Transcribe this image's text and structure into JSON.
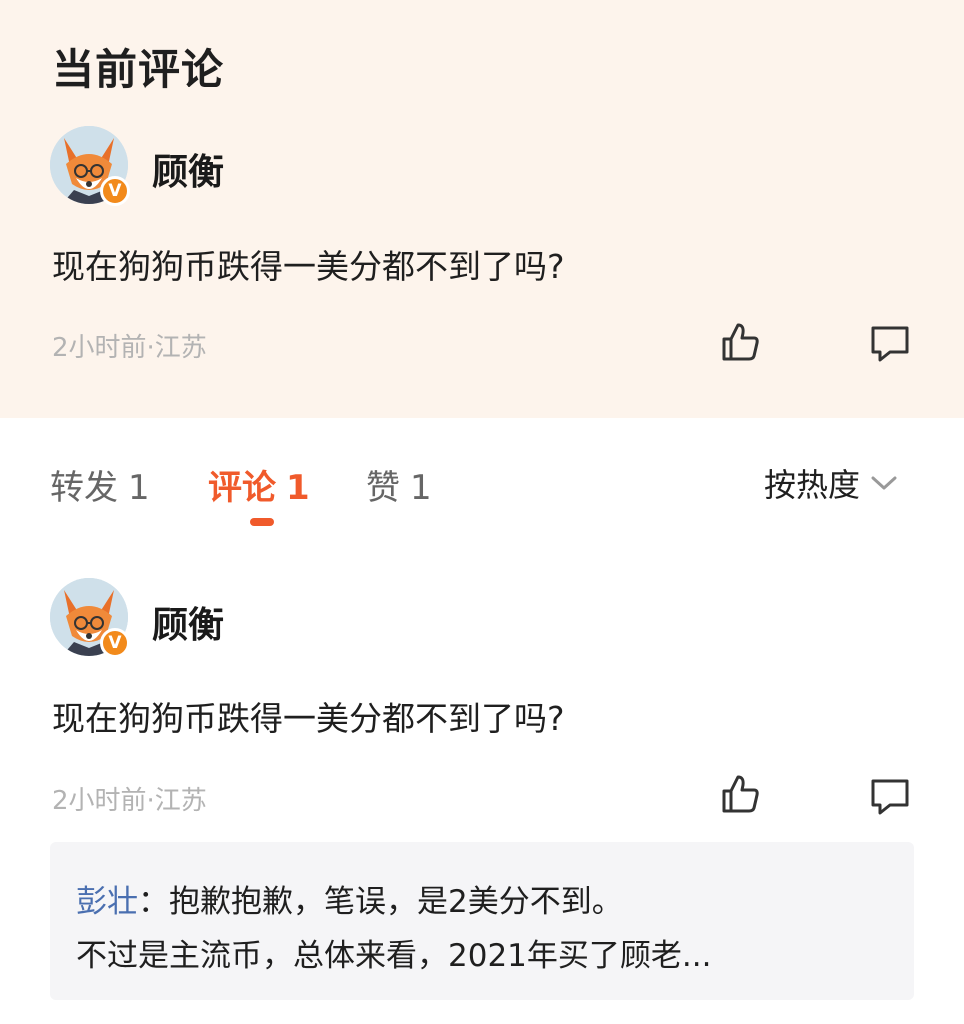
{
  "current_comment": {
    "section_title": "当前评论",
    "author": "顾衡",
    "verified_badge": "V",
    "text": "现在狗狗币跌得一美分都不到了吗?",
    "meta": "2小时前·江苏"
  },
  "tabs": [
    {
      "label": "转发",
      "count": "1"
    },
    {
      "label": "评论",
      "count": "1"
    },
    {
      "label": "赞",
      "count": "1"
    }
  ],
  "active_tab": "评论",
  "sort": {
    "label": "按热度"
  },
  "comments": [
    {
      "author": "顾衡",
      "verified_badge": "V",
      "text": "现在狗狗币跌得一美分都不到了吗?",
      "meta": "2小时前·江苏",
      "reply_preview": {
        "author": "彭壮",
        "separator": "：",
        "line1": "抱歉抱歉，笔误，是2美分不到。",
        "line2": "不过是主流币，总体来看，2021年买了顾老..."
      }
    }
  ],
  "colors": {
    "top_panel_bg": "#fdf4ec",
    "accent": "#f05a2b",
    "verified": "#f28a1b",
    "reply_author": "#4a6fb0",
    "meta_text": "#b3b3b3"
  },
  "icons": [
    "fox-avatar",
    "verified-icon",
    "thumbs-up-icon",
    "comment-icon",
    "chevron-down-icon"
  ]
}
